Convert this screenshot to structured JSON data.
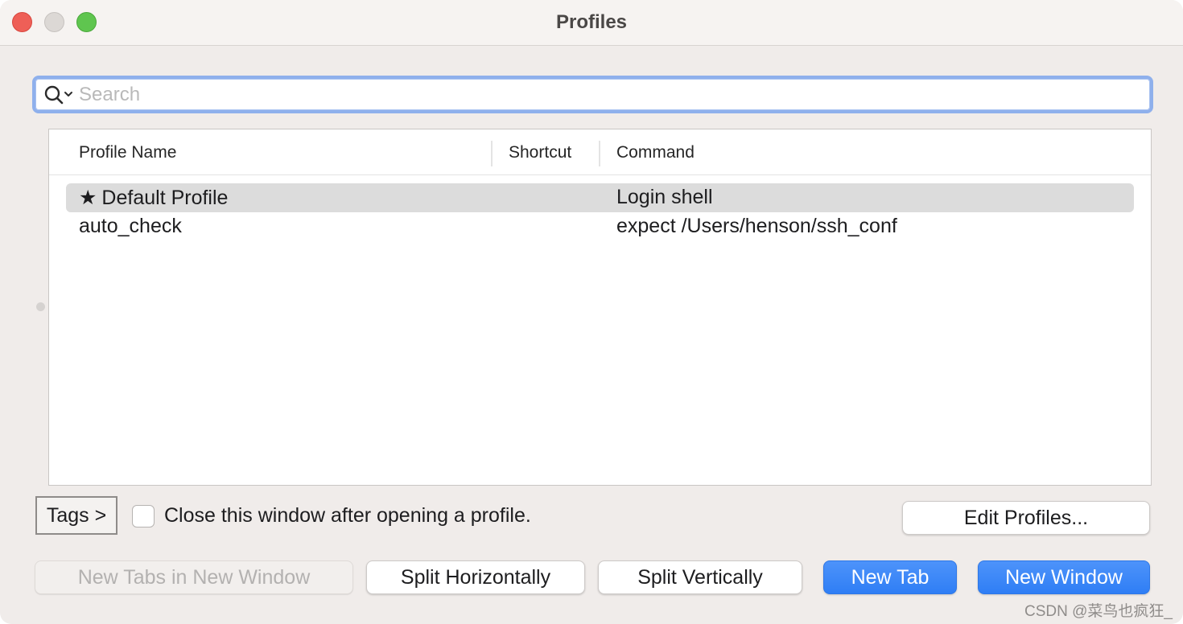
{
  "window": {
    "title": "Profiles"
  },
  "search": {
    "placeholder": "Search",
    "value": ""
  },
  "table": {
    "columns": [
      "Profile Name",
      "Shortcut",
      "Command"
    ],
    "rows": [
      {
        "star": "★",
        "name": "Default Profile",
        "shortcut": "",
        "command": "Login shell",
        "selected": true
      },
      {
        "star": "",
        "name": "auto_check",
        "shortcut": "",
        "command": "expect /Users/henson/ssh_conf",
        "selected": false
      }
    ]
  },
  "controls": {
    "tags_label": "Tags >",
    "close_after_open_label": "Close this window after opening a profile.",
    "close_after_open_checked": false,
    "edit_profiles_label": "Edit Profiles..."
  },
  "buttons": {
    "new_tabs_in_new_window": "New Tabs in New Window",
    "split_horizontally": "Split Horizontally",
    "split_vertically": "Split Vertically",
    "new_tab": "New Tab",
    "new_window": "New Window"
  },
  "watermark": "CSDN @菜鸟也疯狂_",
  "colors": {
    "accent": "#3a86f7",
    "selection": "#dcdcdc",
    "close": "#ee5f57",
    "zoom": "#5fc54f",
    "focus_ring": "#8fb0ec"
  }
}
